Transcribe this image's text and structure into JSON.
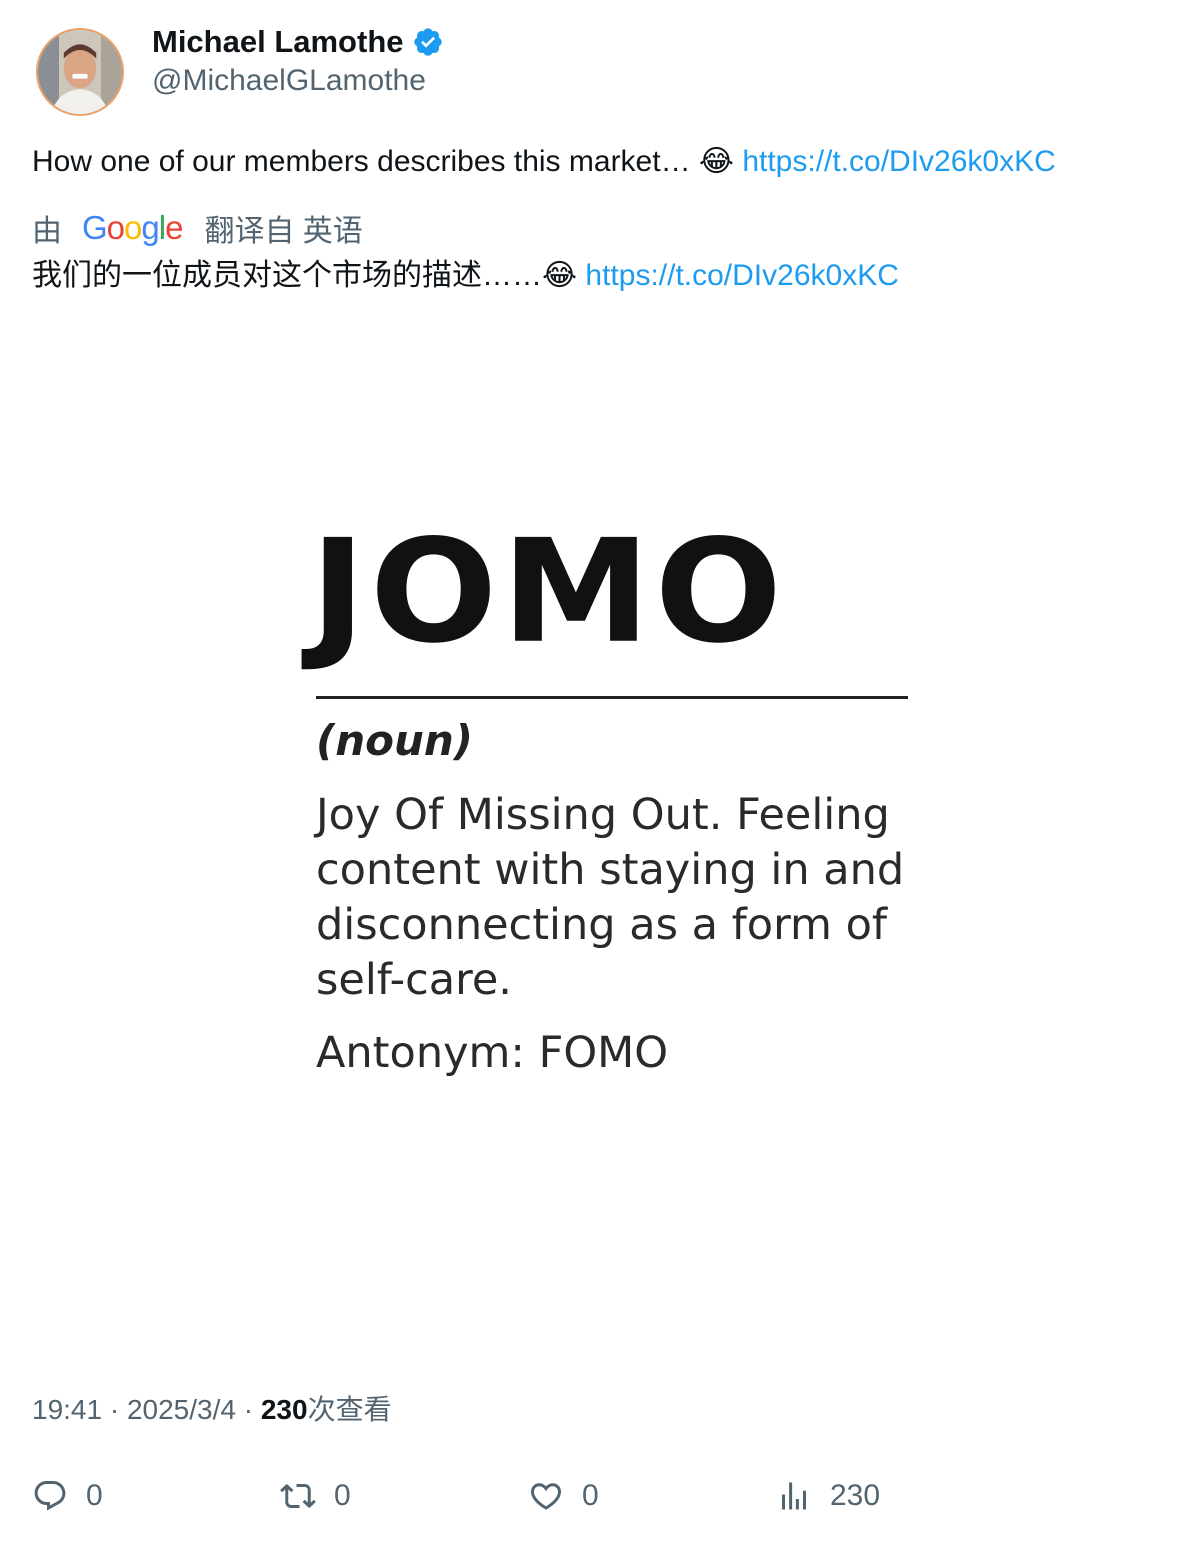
{
  "author": {
    "name": "Michael Lamothe",
    "handle": "@MichaelGLamothe",
    "verified": true
  },
  "tweet": {
    "text": "How one of our members describes this market… ",
    "emoji": "😂",
    "link": "https://t.co/DIv26k0xKC"
  },
  "translation": {
    "prefix": "由",
    "provider": "Google",
    "suffix": "翻译自 英语",
    "text": "我们的一位成员对这个市场的描述……",
    "emoji": "😂",
    "link": "https://t.co/DIv26k0xKC"
  },
  "media": {
    "word": "JOMO",
    "part_of_speech": "(noun)",
    "definition": "Joy Of Missing Out. Feeling content with staying in and disconnecting as a form of self-care.",
    "antonym": "Antonym: FOMO"
  },
  "meta": {
    "time": "19:41",
    "separator": " · ",
    "date": "2025/3/4",
    "views_count": "230",
    "views_label": "次查看"
  },
  "actions": {
    "replies": "0",
    "retweets": "0",
    "likes": "0",
    "views": "230"
  },
  "colors": {
    "link": "#1d9bf0",
    "secondary_text": "#536471",
    "verified": "#1d9bf0"
  }
}
